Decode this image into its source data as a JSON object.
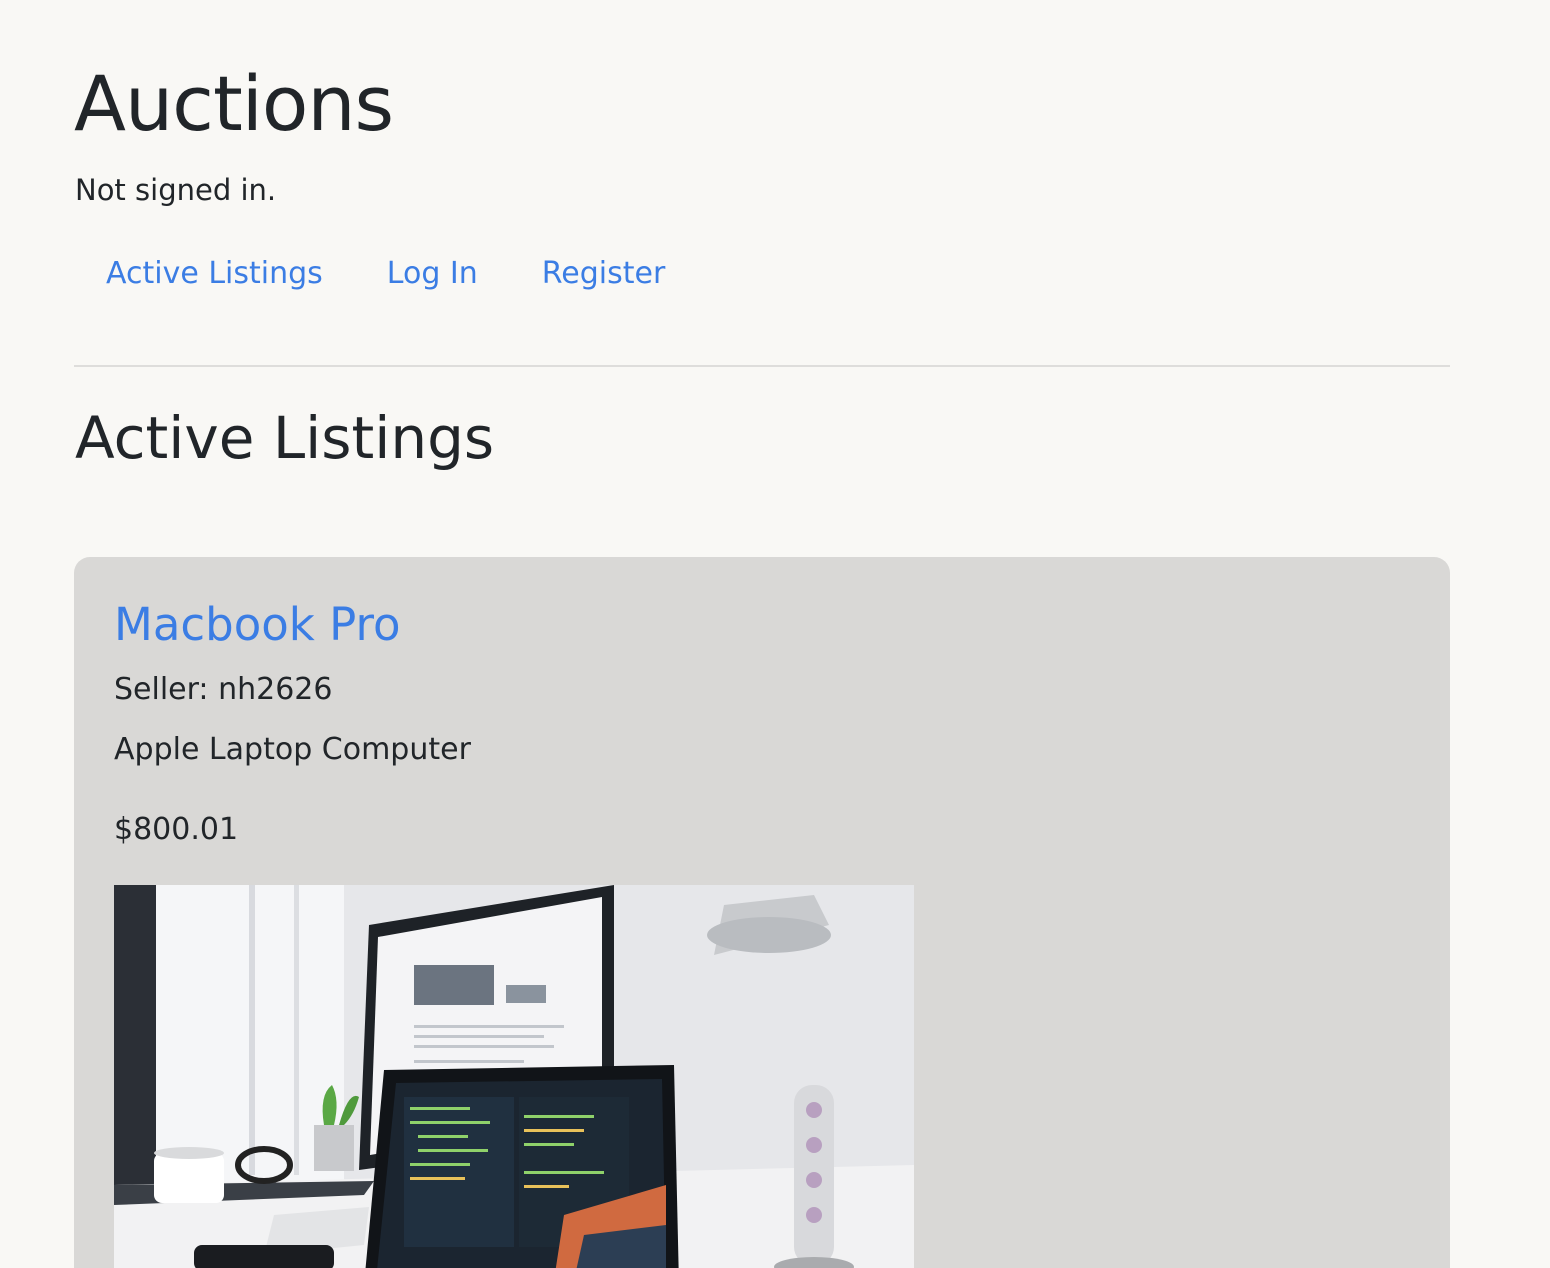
{
  "header": {
    "title": "Auctions",
    "auth_status": "Not signed in."
  },
  "nav": {
    "items": [
      {
        "label": "Active Listings"
      },
      {
        "label": "Log In"
      },
      {
        "label": "Register"
      }
    ]
  },
  "main": {
    "section_title": "Active Listings",
    "listings": [
      {
        "title": "Macbook Pro",
        "seller": "Seller: nh2626",
        "description": "Apple Laptop Computer",
        "price": "$800.01"
      }
    ]
  },
  "colors": {
    "background": "#f9f8f5",
    "link": "#3b7de4",
    "card_background": "#d9d8d6",
    "text": "#212529"
  }
}
